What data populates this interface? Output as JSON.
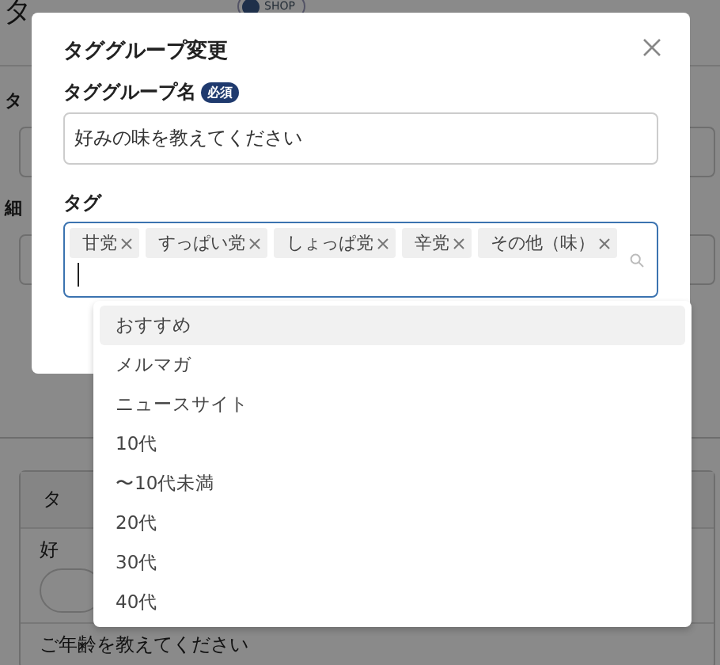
{
  "page": {
    "title": "タ",
    "badge": "SHOP",
    "fields": [
      {
        "label": "タ"
      },
      {
        "label": "細"
      }
    ],
    "card": {
      "header": "タ",
      "group_name": "好",
      "next_group": "ご年齢を教えてください"
    }
  },
  "modal": {
    "title": "タググループ変更",
    "name_label": "タググループ名",
    "required_badge": "必須",
    "name_value": "好みの味を教えてください",
    "tags_label": "タグ",
    "tags": [
      {
        "label": "甘党"
      },
      {
        "label": "すっぱい党"
      },
      {
        "label": "しょっぱ党"
      },
      {
        "label": "辛党"
      },
      {
        "label": "その他（味）"
      }
    ],
    "options": [
      {
        "label": "おすすめ",
        "selected": true
      },
      {
        "label": "メルマガ",
        "selected": false
      },
      {
        "label": "ニュースサイト",
        "selected": false
      },
      {
        "label": "10代",
        "selected": false
      },
      {
        "label": "〜10代未満",
        "selected": false
      },
      {
        "label": "20代",
        "selected": false
      },
      {
        "label": "30代",
        "selected": false
      },
      {
        "label": "40代",
        "selected": false
      }
    ]
  }
}
